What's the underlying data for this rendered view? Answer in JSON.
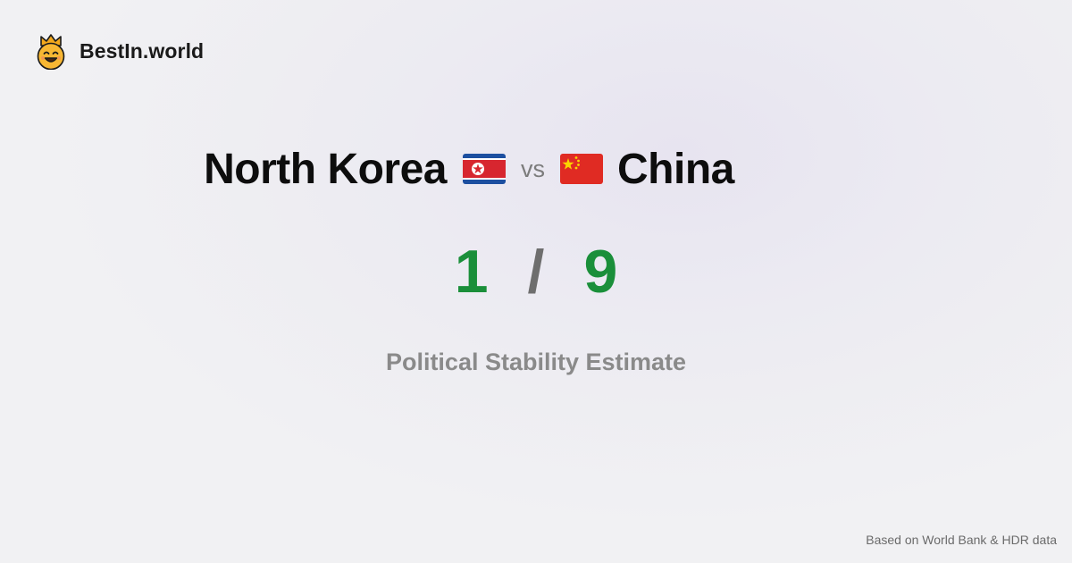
{
  "brand": {
    "name": "BestIn.world",
    "logo_icon": "smiling-face-crown-icon"
  },
  "comparison": {
    "left": {
      "country": "North Korea",
      "flag_icon": "north-korea-flag-icon",
      "score": "1"
    },
    "separator": "vs",
    "right": {
      "country": "China",
      "flag_icon": "china-flag-icon",
      "score": "9"
    },
    "score_separator": "/",
    "metric": "Political Stability Estimate"
  },
  "footer": {
    "source": "Based on World Bank & HDR data"
  },
  "colors": {
    "score": "#1a8f3a",
    "crown": "#f2a81c",
    "face": "#f7b733"
  }
}
